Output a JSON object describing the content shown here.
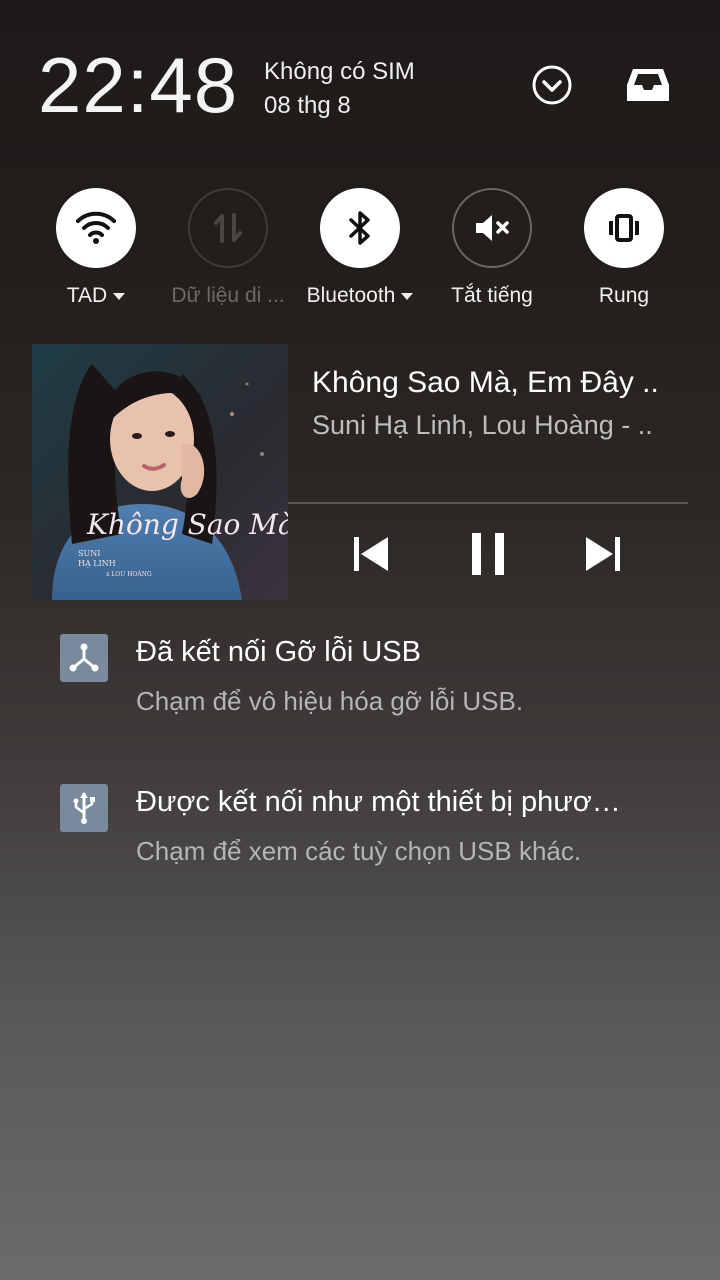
{
  "status": {
    "time": "22:48",
    "carrier": "Không có SIM",
    "date": "08 thg 8"
  },
  "header_icons": [
    "chevron-down-circle-icon",
    "inbox-tray-icon"
  ],
  "quick_toggles": [
    {
      "label": "TAD",
      "icon": "wifi-icon",
      "state": "on",
      "has_menu": true
    },
    {
      "label": "Dữ liệu di ...",
      "icon": "mobile-data-icon",
      "state": "disabled",
      "has_menu": false
    },
    {
      "label": "Bluetooth",
      "icon": "bluetooth-icon",
      "state": "on",
      "has_menu": true
    },
    {
      "label": "Tắt tiếng",
      "icon": "mute-icon",
      "state": "off",
      "has_menu": false
    },
    {
      "label": "Rung",
      "icon": "vibrate-icon",
      "state": "on",
      "has_menu": false
    }
  ],
  "media": {
    "title": "Không Sao Mà, Em Đây ..",
    "artist": "Suni Hạ Linh, Lou Hoàng - ..",
    "album_art_text": "Không Sao Mà, Em Đây Rồi",
    "controls": [
      "previous-icon",
      "pause-icon",
      "next-icon"
    ]
  },
  "notifications": [
    {
      "icon": "usb-debug-icon",
      "title": "Đã kết nối Gỡ lỗi USB",
      "text": "Chạm để vô hiệu hóa gỡ lỗi USB."
    },
    {
      "icon": "usb-icon",
      "title": "Được kết nối như một thiết bị phươ…",
      "text": "Chạm để xem các tuỳ chọn USB khác."
    }
  ],
  "colors": {
    "toggle_on": "#ffffff",
    "toggle_off_border": "#6a6664",
    "secondary_text": "#b5b5b5",
    "notif_icon_bg": "#7a8a9c"
  }
}
